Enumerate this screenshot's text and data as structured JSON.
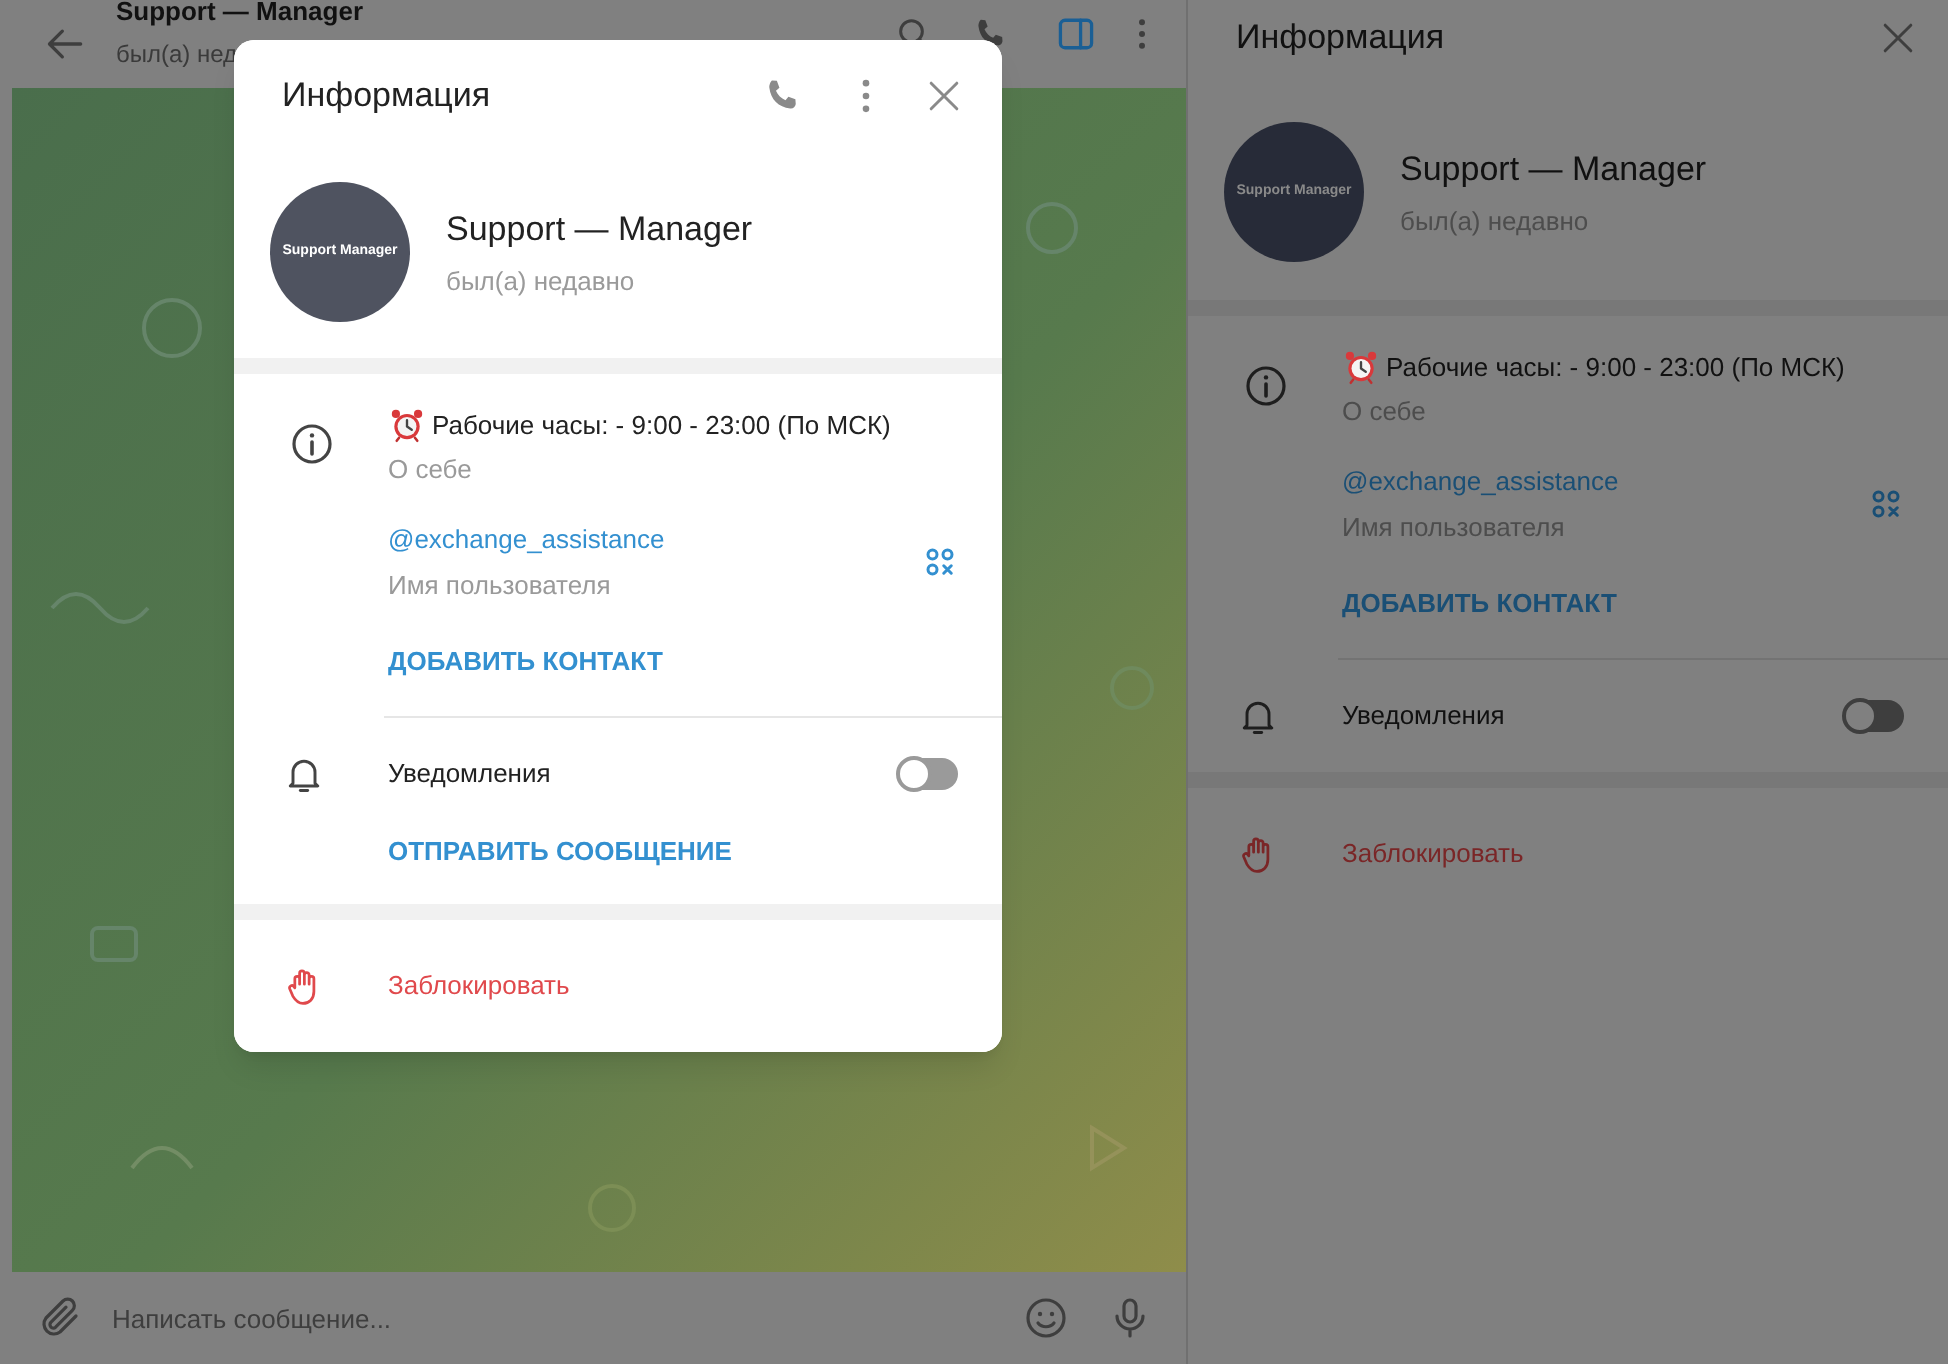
{
  "chat": {
    "title": "Support — Manager",
    "status": "был(а) нед",
    "input": {
      "placeholder": "Написать сообщение..."
    }
  },
  "info_panel": {
    "title": "Информация",
    "avatar_text": "Support Manager",
    "name": "Support — Manager",
    "status": "был(а) недавно",
    "about": "Рабочие часы: - 9:00 - 23:00 (По МСК)",
    "about_label": "О себе",
    "username": "@exchange_assistance",
    "username_label": "Имя пользователя",
    "add_contact": "ДОБАВИТЬ КОНТАКТ",
    "notifications": {
      "label": "Уведомления",
      "on": false
    },
    "block": "Заблокировать"
  },
  "dialog": {
    "title": "Информация",
    "avatar_text": "Support Manager",
    "name": "Support — Manager",
    "status": "был(а) недавно",
    "about": "Рабочие часы: - 9:00 - 23:00 (По МСК)",
    "about_label": "О себе",
    "username": "@exchange_assistance",
    "username_label": "Имя пользователя",
    "add_contact": "ДОБАВИТЬ КОНТАКТ",
    "notifications": {
      "label": "Уведомления",
      "on": false
    },
    "send_message": "ОТПРАВИТЬ СООБЩЕНИЕ",
    "block": "Заблокировать"
  }
}
